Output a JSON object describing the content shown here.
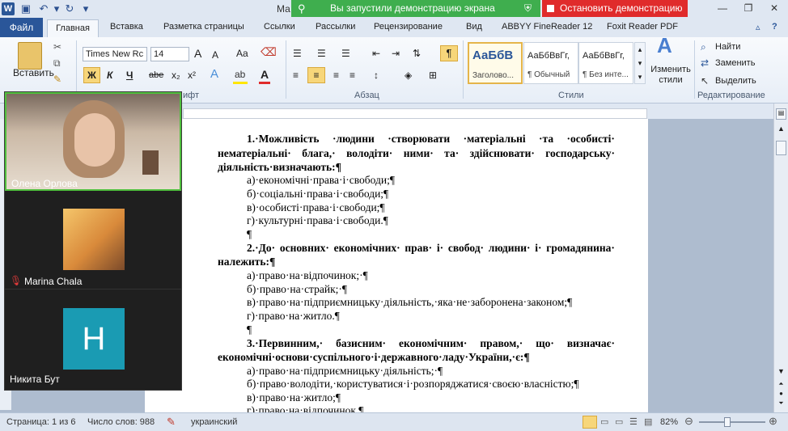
{
  "titlebar": {
    "title": "Ма",
    "share_status": "Вы запустили демонстрацию экрана",
    "stop_share": "Остановить демонстрацию",
    "brand_color": "#2b5797",
    "share_color": "#3fae4e",
    "stop_color": "#e02b2b"
  },
  "tabs": {
    "file": "Файл",
    "items": [
      "Главная",
      "Вставка",
      "Разметка страницы",
      "Ссылки",
      "Рассылки",
      "Рецензирование",
      "Вид",
      "ABBYY FineReader 12",
      "Foxit Reader PDF"
    ]
  },
  "ribbon": {
    "paste": "Вставить",
    "font_name": "Times New Rc",
    "font_size": "14",
    "font_grow": "A",
    "font_shrink": "A",
    "change_case": "Aa",
    "bold": "Ж",
    "italic": "К",
    "underline": "Ч",
    "strike": "abe",
    "subscript": "x₂",
    "superscript": "x²",
    "groups": {
      "font": "ифт",
      "paragraph": "Абзац",
      "styles": "Стили",
      "editing": "Редактирование"
    },
    "styles": [
      {
        "preview": "АаБбВ",
        "name": "Заголово..."
      },
      {
        "preview": "АаБбВвГг,",
        "name": "¶ Обычный"
      },
      {
        "preview": "АаБбВвГг,",
        "name": "¶ Без инте..."
      }
    ],
    "change_styles": "Изменить стили",
    "find": "Найти",
    "replace": "Заменить",
    "select": "Выделить"
  },
  "document": {
    "q1_line1": [
      "1.·Можливість",
      "·людини",
      "·створювати",
      "·матеріальні",
      "·та",
      "·особисті·"
    ],
    "q1_line2": [
      "нематеріальні·",
      "блага,·",
      "володіти·",
      "ними·",
      "та·",
      "здійснювати·",
      "господарську·"
    ],
    "q1_line3": "діяльність·визначають:¶",
    "q1_options": [
      "а)·економічні·права·і·свободи;¶",
      "б)·соціальні·права·і·свободи;¶",
      "в)·особисті·права·і·свободи;¶",
      "г)·культурні·права·і·свободи.¶"
    ],
    "pilcrow": "¶",
    "q2_line1": [
      "2.·До·",
      "основних·",
      "економічних·",
      "прав·",
      "і·",
      "свобод·",
      "людини·",
      "і·",
      "громадянина·"
    ],
    "q2_line2": "належить:¶",
    "q2_options": [
      "а)·право·на·відпочинок;·¶",
      "б)·право·на·страйк;·¶",
      "в)·право·на·підприємницьку·діяльність,·яка·не·заборонена·законом;¶",
      "г)·право·на·житло.¶"
    ],
    "q3_line1": [
      "3.·Первинним,·",
      "базисним·",
      "економічним·",
      "правом,·",
      "що·",
      "визначає·"
    ],
    "q3_line2": "економічні·основи·суспільного·і·державного·ладу·України,·є:¶",
    "q3_options": [
      "а)·право·на·підприємницьку·діяльність;·¶",
      "б)·право·володіти,·користуватися·і·розпоряджатися·своєю·власністю;¶",
      "в)·право·на·житло;¶",
      "г)·право·на·відпочинок.¶"
    ]
  },
  "participants": [
    {
      "name": "Олена Орлова",
      "video": true
    },
    {
      "name": "Marina Chala",
      "muted": true
    },
    {
      "name": "Никита Бут",
      "initial": "H",
      "avatar_color": "#1a9bb3"
    }
  ],
  "status": {
    "page": "Страница: 1 из 6",
    "words": "Число слов: 988",
    "language": "украинский",
    "zoom": "82%"
  }
}
